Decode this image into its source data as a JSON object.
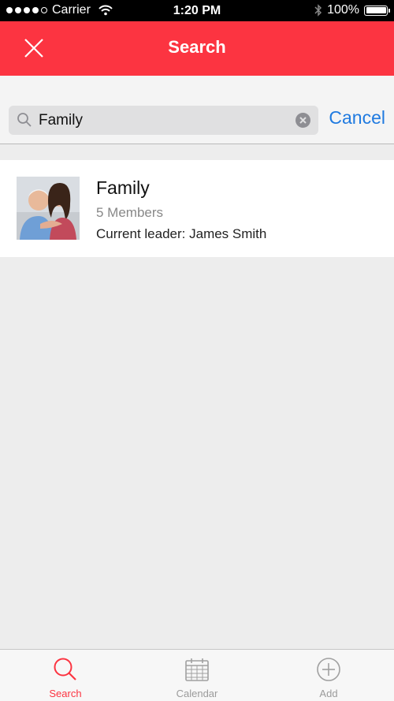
{
  "status_bar": {
    "carrier": "Carrier",
    "time": "1:20 PM",
    "battery": "100%",
    "battery_level": 1.0,
    "signal_bars": 4
  },
  "nav_bar": {
    "title": "Search",
    "close_icon": "close-icon",
    "color": "#fc3441"
  },
  "search": {
    "value": "Family",
    "cancel_label": "Cancel",
    "search_icon": "search-icon",
    "clear_icon": "clear-icon"
  },
  "results": [
    {
      "name": "Family",
      "members": "5 Members",
      "leader": "Current leader: James Smith",
      "thumbnail": "family-photo"
    }
  ],
  "tab_bar": {
    "tabs": [
      {
        "label": "Search",
        "icon": "search-icon",
        "active": true
      },
      {
        "label": "Calendar",
        "icon": "calendar-icon",
        "active": false
      },
      {
        "label": "Add",
        "icon": "add-icon",
        "active": false
      }
    ],
    "active_color": "#fc3441",
    "inactive_color": "#9b9b9b"
  }
}
